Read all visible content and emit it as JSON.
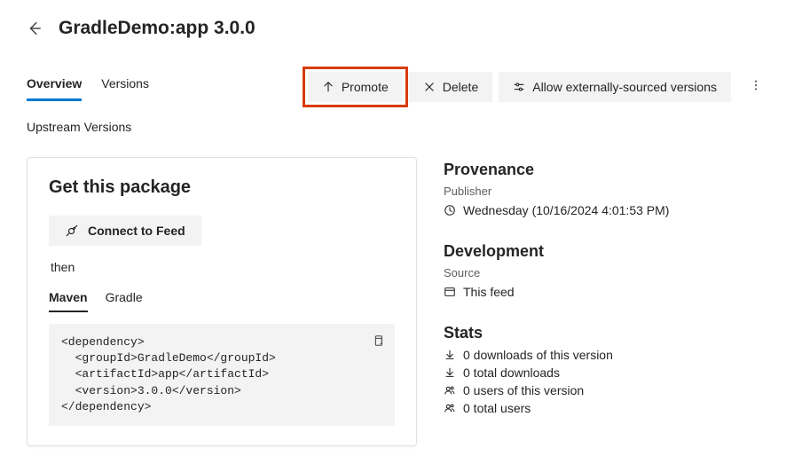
{
  "header": {
    "title": "GradleDemo:app 3.0.0"
  },
  "tabs": {
    "overview": "Overview",
    "versions": "Versions"
  },
  "commands": {
    "promote": "Promote",
    "delete": "Delete",
    "allow_external": "Allow externally-sourced versions"
  },
  "upstream_label": "Upstream Versions",
  "get_package": {
    "title": "Get this package",
    "connect_label": "Connect to Feed",
    "then": "then",
    "subtabs": {
      "maven": "Maven",
      "gradle": "Gradle"
    },
    "code": "<dependency>\n  <groupId>GradleDemo</groupId>\n  <artifactId>app</artifactId>\n  <version>3.0.0</version>\n</dependency>"
  },
  "provenance": {
    "title": "Provenance",
    "publisher_label": "Publisher",
    "timestamp": "Wednesday (10/16/2024 4:01:53 PM)"
  },
  "development": {
    "title": "Development",
    "source_label": "Source",
    "source_value": "This feed"
  },
  "stats": {
    "title": "Stats",
    "downloads_version": "0 downloads of this version",
    "downloads_total": "0 total downloads",
    "users_version": "0 users of this version",
    "users_total": "0 total users"
  }
}
